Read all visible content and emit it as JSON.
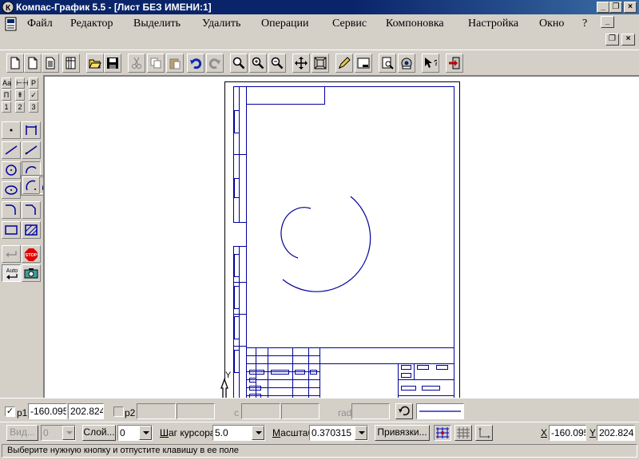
{
  "window": {
    "title": "Компас-График 5.5 - [Лист БЕЗ ИМЕНИ:1]",
    "controls": {
      "minimize": "_",
      "restore": "❐",
      "close": "×"
    }
  },
  "menu": {
    "items": [
      "Файл",
      "Редактор",
      "Выделить",
      "Удалить",
      "Операции",
      "Сервис",
      "Компоновка",
      "Настройка",
      "Окно",
      "?"
    ]
  },
  "toolbar": {
    "buttons": [
      {
        "name": "new-sheet",
        "icon": "new-sheet-icon"
      },
      {
        "name": "new-fragment",
        "icon": "new-fragment-icon"
      },
      {
        "name": "new-text",
        "icon": "new-text-doc-icon"
      },
      {
        "name": "new-spec",
        "icon": "new-spec-icon"
      },
      {
        "name": "open",
        "icon": "open-folder-icon"
      },
      {
        "name": "save",
        "icon": "save-icon"
      },
      {
        "name": "cut",
        "icon": "cut-icon"
      },
      {
        "name": "copy",
        "icon": "copy-icon"
      },
      {
        "name": "paste",
        "icon": "paste-icon"
      },
      {
        "name": "undo",
        "icon": "undo-icon"
      },
      {
        "name": "redo",
        "icon": "redo-icon"
      },
      {
        "name": "zoom-window",
        "icon": "zoom-icon"
      },
      {
        "name": "zoom-in",
        "icon": "zoom-in-icon"
      },
      {
        "name": "zoom-out",
        "icon": "zoom-out-icon"
      },
      {
        "name": "pan",
        "icon": "pan-icon"
      },
      {
        "name": "show-all",
        "icon": "show-all-icon"
      },
      {
        "name": "edit-style",
        "icon": "pencil-icon"
      },
      {
        "name": "sheet-format",
        "icon": "sheet-format-icon"
      },
      {
        "name": "print-preview",
        "icon": "print-preview-icon"
      },
      {
        "name": "print",
        "icon": "print-icon"
      },
      {
        "name": "context-help",
        "icon": "help-arrow-icon"
      },
      {
        "name": "exit",
        "icon": "exit-icon"
      }
    ]
  },
  "toolbox": {
    "top_tabs": [
      "Аа",
      "⊢⊣",
      "Р",
      "П",
      "⇞",
      "✓",
      "1",
      "2",
      "3"
    ]
  },
  "property_bar": {
    "p1_label": "p1",
    "p1_checked": true,
    "p1_x": "-160.095",
    "p1_y": "202.824",
    "p2_label": "p2",
    "p2_checked": false,
    "c_label": "c",
    "rad_label": "rad"
  },
  "bottom_bar": {
    "view_button": "Вид...",
    "view_value": "0",
    "layer_button": "Слой...",
    "layer_value": "0",
    "step_label_u": "Ш",
    "step_label_rest": "аг курсора",
    "step_value": "5.0",
    "scale_label_u": "М",
    "scale_label_rest": "асштаб",
    "scale_value": "0.370315",
    "snaps_button": "Привязки...",
    "x_label": "X",
    "x_value": "-160.095",
    "y_label": "Y",
    "y_value": "202.824"
  },
  "status": {
    "message": "Выберите нужную кнопку и отпустите клавишу в ее поле"
  },
  "drawing": {
    "line_color": "#00009c",
    "axis_label": "Y"
  }
}
